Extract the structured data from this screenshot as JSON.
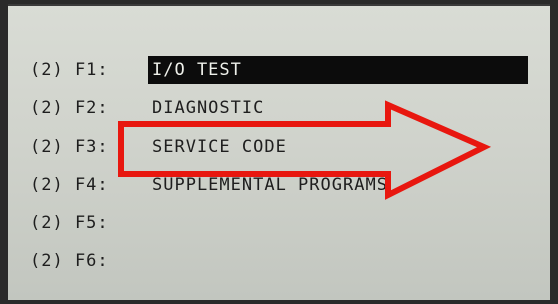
{
  "menu": {
    "items": [
      {
        "key": "(2) F1:",
        "label": "I/O TEST",
        "selected": true
      },
      {
        "key": "(2) F2:",
        "label": "DIAGNOSTIC",
        "selected": false
      },
      {
        "key": "(2) F3:",
        "label": "SERVICE CODE",
        "selected": false
      },
      {
        "key": "(2) F4:",
        "label": "SUPPLEMENTAL PROGRAMS",
        "selected": false
      },
      {
        "key": "(2) F5:",
        "label": "",
        "selected": false
      },
      {
        "key": "(2) F6:",
        "label": "",
        "selected": false
      }
    ]
  },
  "annotation": {
    "arrow_color": "#e8170f",
    "icon": "right-arrow-icon"
  },
  "colors": {
    "screen_bg": "#d4d7d0",
    "text": "#1e1e1e",
    "highlight_bg": "#0c0c0c",
    "highlight_text": "#eef0ea"
  }
}
